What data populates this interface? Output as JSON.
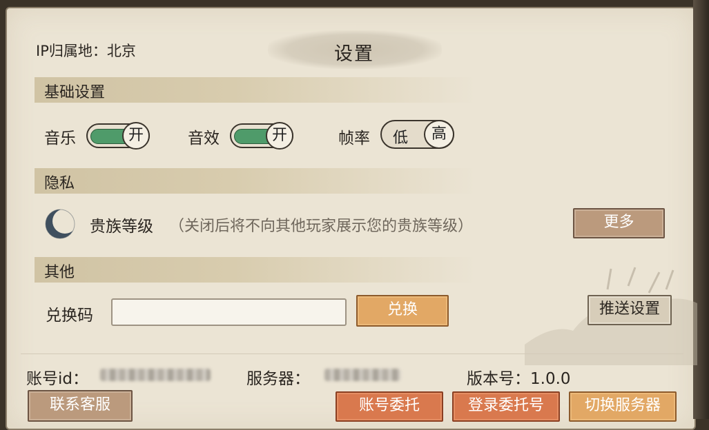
{
  "header": {
    "ip_location": "IP归属地：北京",
    "title": "设置"
  },
  "sections": {
    "basic": "基础设置",
    "privacy": "隐私",
    "other": "其他"
  },
  "basic_settings": {
    "music_label": "音乐",
    "music_state": "开",
    "sound_label": "音效",
    "sound_state": "开",
    "framerate_label": "帧率",
    "framerate_low": "低",
    "framerate_high": "高",
    "framerate_selected": "高"
  },
  "privacy": {
    "noble_label": "贵族等级",
    "noble_note": "（关闭后将不向其他玩家展示您的贵族等级）",
    "more_button": "更多"
  },
  "other": {
    "redeem_label": "兑换码",
    "redeem_value": "",
    "redeem_placeholder": "",
    "redeem_button": "兑换",
    "push_button": "推送设置"
  },
  "footer": {
    "account_label": "账号id：",
    "server_label": "服务器：",
    "version_label": "版本号：1.0.0",
    "contact_button": "联系客服",
    "account_entrust_button": "账号委托",
    "login_entrust_button": "登录委托号",
    "switch_server_button": "切换服务器"
  },
  "colors": {
    "panel_bg": "#ebe4d4",
    "toggle_on": "#4f9b6a",
    "brown_button": "#bb9a7d",
    "orange_button": "#e2a865",
    "red_button": "#d9794e"
  }
}
